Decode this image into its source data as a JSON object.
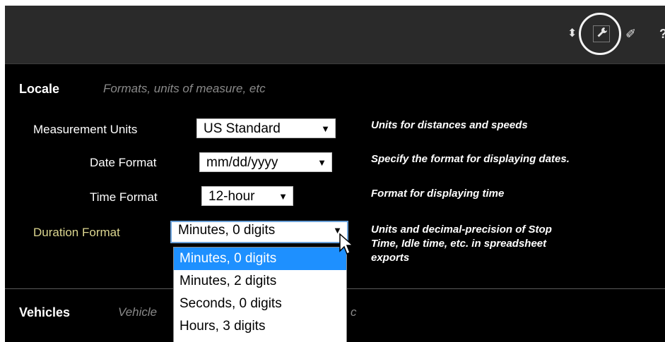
{
  "toolbar": {
    "icons": [
      "sort-icon",
      "wrench-icon",
      "eraser-icon",
      "help-icon"
    ],
    "sort_glyph": "⬍",
    "wrench_glyph": "🔧",
    "eraser_glyph": "✐",
    "help_glyph": "?"
  },
  "locale": {
    "title": "Locale",
    "description": "Formats, units of measure, etc",
    "fields": [
      {
        "label": "Measurement Units",
        "value": "US Standard",
        "help": "Units for distances and speeds"
      },
      {
        "label": "Date Format",
        "value": "mm/dd/yyyy",
        "help": "Specify the format for displaying dates."
      },
      {
        "label": "Time Format",
        "value": "12-hour",
        "help": "Format for displaying time"
      },
      {
        "label": "Duration Format",
        "value": "Minutes, 0 digits",
        "help_lines": [
          "Units and decimal-precision of Stop",
          "Time, Idle time, etc. in spreadsheet",
          "exports"
        ]
      }
    ],
    "duration_options": [
      "Minutes, 0 digits",
      "Minutes, 2 digits",
      "Seconds, 0 digits",
      "Hours, 3 digits"
    ]
  },
  "vehicles": {
    "title": "Vehicles",
    "description_visible_start": "Vehicle",
    "description_visible_end": "c"
  },
  "colors": {
    "panel_bg": "#000000",
    "toolbar_bg": "#2a2a2a",
    "active_label": "#dcd690",
    "selection": "#1e90ff"
  }
}
